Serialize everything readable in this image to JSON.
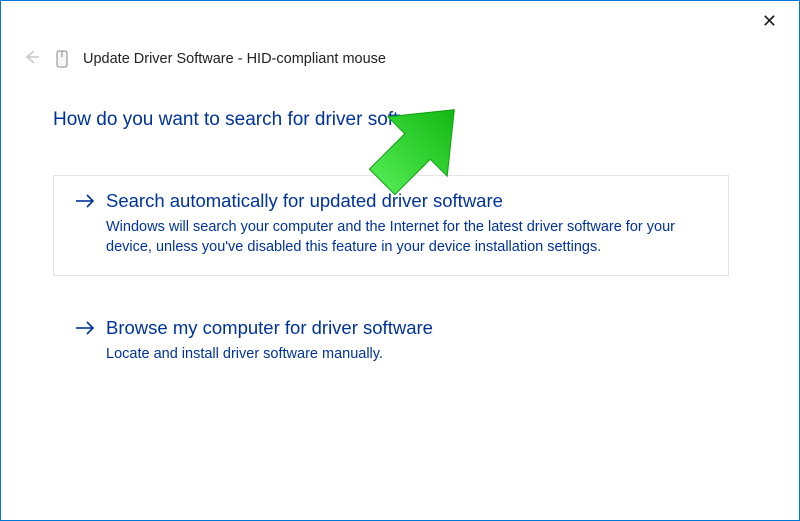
{
  "header": {
    "title": "Update Driver Software - HID-compliant mouse"
  },
  "main": {
    "question": "How do you want to search for driver software?",
    "options": [
      {
        "title": "Search automatically for updated driver software",
        "description": "Windows will search your computer and the Internet for the latest driver software for your device, unless you've disabled this feature in your device installation settings."
      },
      {
        "title": "Browse my computer for driver software",
        "description": "Locate and install driver software manually."
      }
    ]
  },
  "annotation_color": "#2ecc40"
}
